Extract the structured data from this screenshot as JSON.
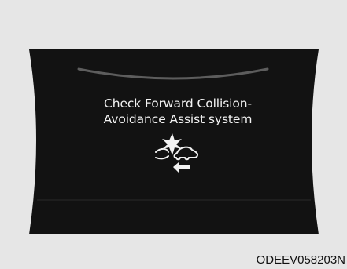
{
  "display": {
    "message_line_1": "Check Forward Collision-",
    "message_line_2": "Avoidance Assist system",
    "icon": "forward-collision-avoidance-warning-icon"
  },
  "figure": {
    "code": "ODEEV058203N"
  },
  "colors": {
    "page_background": "#e6e6e6",
    "display_background": "#121212",
    "text": "#f2f2f2",
    "caption_text": "#111111"
  }
}
